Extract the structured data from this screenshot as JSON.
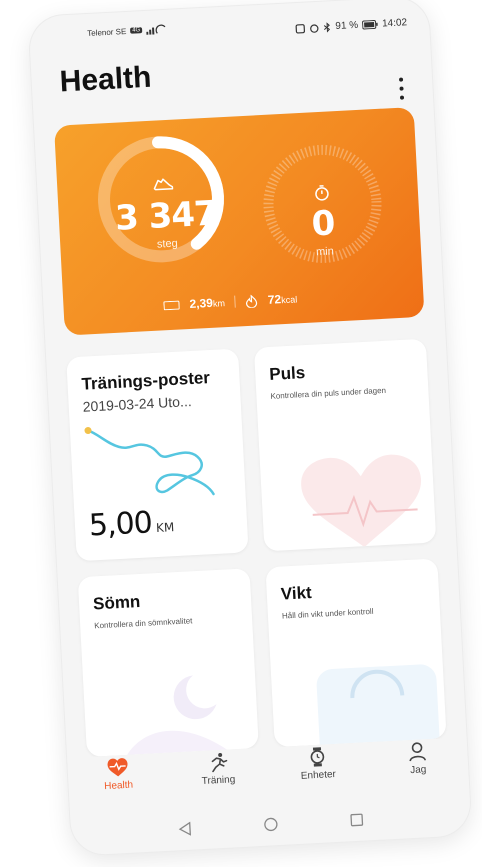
{
  "status": {
    "carrier": "Telenor SE",
    "carrier_badge": "4G",
    "signal_icon": "signal-icon",
    "right": "91 %",
    "time": "14:02"
  },
  "app": {
    "title": "Health",
    "menu_icon": "more-vert-icon"
  },
  "activity": {
    "steps_value": "3 347",
    "steps_unit": "steg",
    "steps_progress": 0.4,
    "minutes_value": "0",
    "minutes_unit": "min",
    "minutes_progress": 0,
    "distance_value": "2,39",
    "distance_unit": "km",
    "calories_value": "72",
    "calories_unit": "kcal",
    "accent": "#f38a22"
  },
  "cards": {
    "training": {
      "title": "Tränings-poster",
      "date": "2019-03-24 Uto...",
      "distance": "5,00",
      "distance_unit": "KM"
    },
    "pulse": {
      "title": "Puls",
      "subtitle": "Kontrollera din puls under dagen"
    },
    "sleep": {
      "title": "Sömn",
      "subtitle": "Kontrollera din sömnkvalitet"
    },
    "weight": {
      "title": "Vikt",
      "subtitle": "Håll din vikt under kontroll"
    }
  },
  "nav": {
    "items": [
      {
        "label": "Health",
        "icon": "heart-pulse-icon"
      },
      {
        "label": "Träning",
        "icon": "running-icon"
      },
      {
        "label": "Enheter",
        "icon": "watch-icon"
      },
      {
        "label": "Jag",
        "icon": "user-icon"
      }
    ],
    "active_color": "#f05a28"
  },
  "system_nav": {
    "icons": [
      "back-icon",
      "home-icon",
      "recents-icon"
    ]
  }
}
